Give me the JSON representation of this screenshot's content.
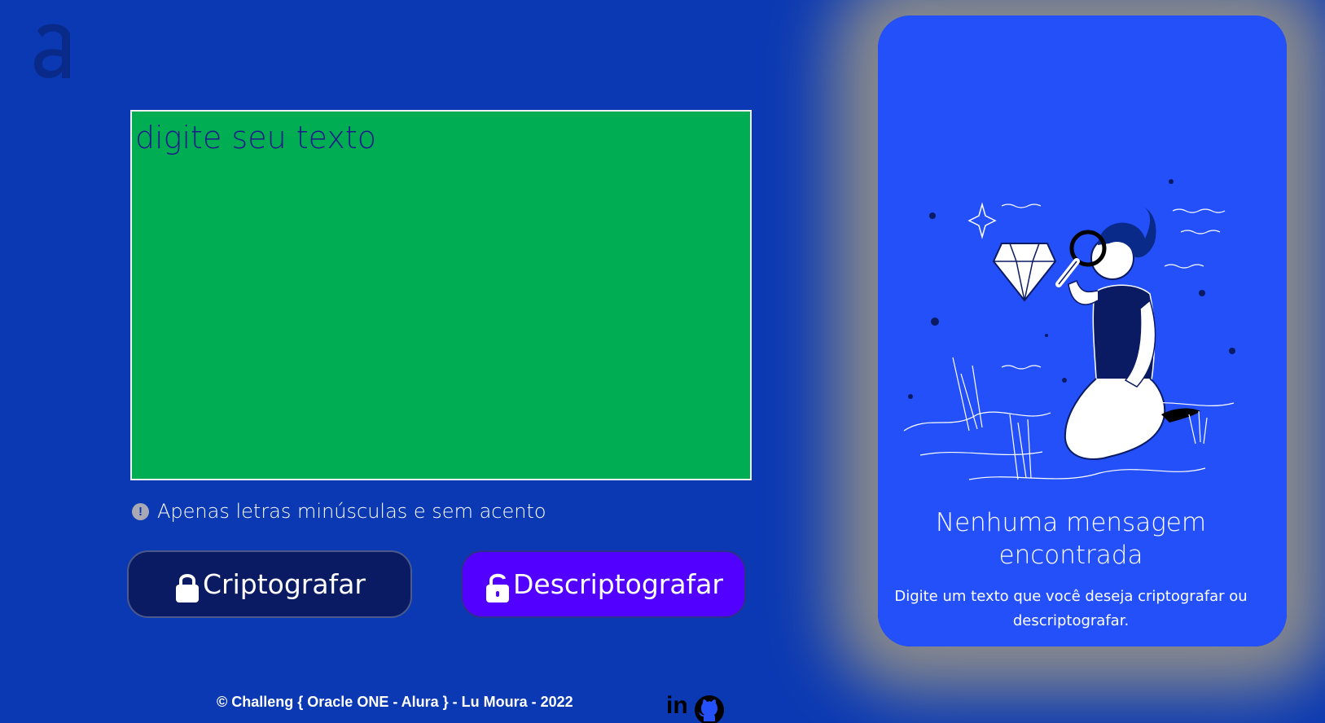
{
  "header": {
    "logo_icon": "alura-a-logo"
  },
  "input": {
    "placeholder": "digite seu texto",
    "value": ""
  },
  "hint": {
    "icon": "exclamation-circle-icon",
    "text": "Apenas letras minúsculas e sem acento"
  },
  "buttons": {
    "encrypt_label": "Criptografar",
    "encrypt_icon": "lock-icon",
    "decrypt_label": "Descriptografar",
    "decrypt_icon": "unlock-icon"
  },
  "output_panel": {
    "illustration": "person-inspecting-diamond-illustration",
    "title": "Nenhuma mensagem encontrada",
    "subtitle": "Digite um texto que você deseja criptografar ou descriptografar."
  },
  "footer": {
    "text": "© Challeng { Oracle ONE - Alura } - Lu Moura - 2022",
    "linkedin_label": "in",
    "linkedin_icon": "linkedin-icon",
    "github_icon": "github-icon"
  },
  "colors": {
    "background": "#0a39b3",
    "textarea": "#00ad53",
    "encrypt_button": "#0a1a63",
    "decrypt_button": "#5200ff",
    "panel": "#2450fa"
  }
}
